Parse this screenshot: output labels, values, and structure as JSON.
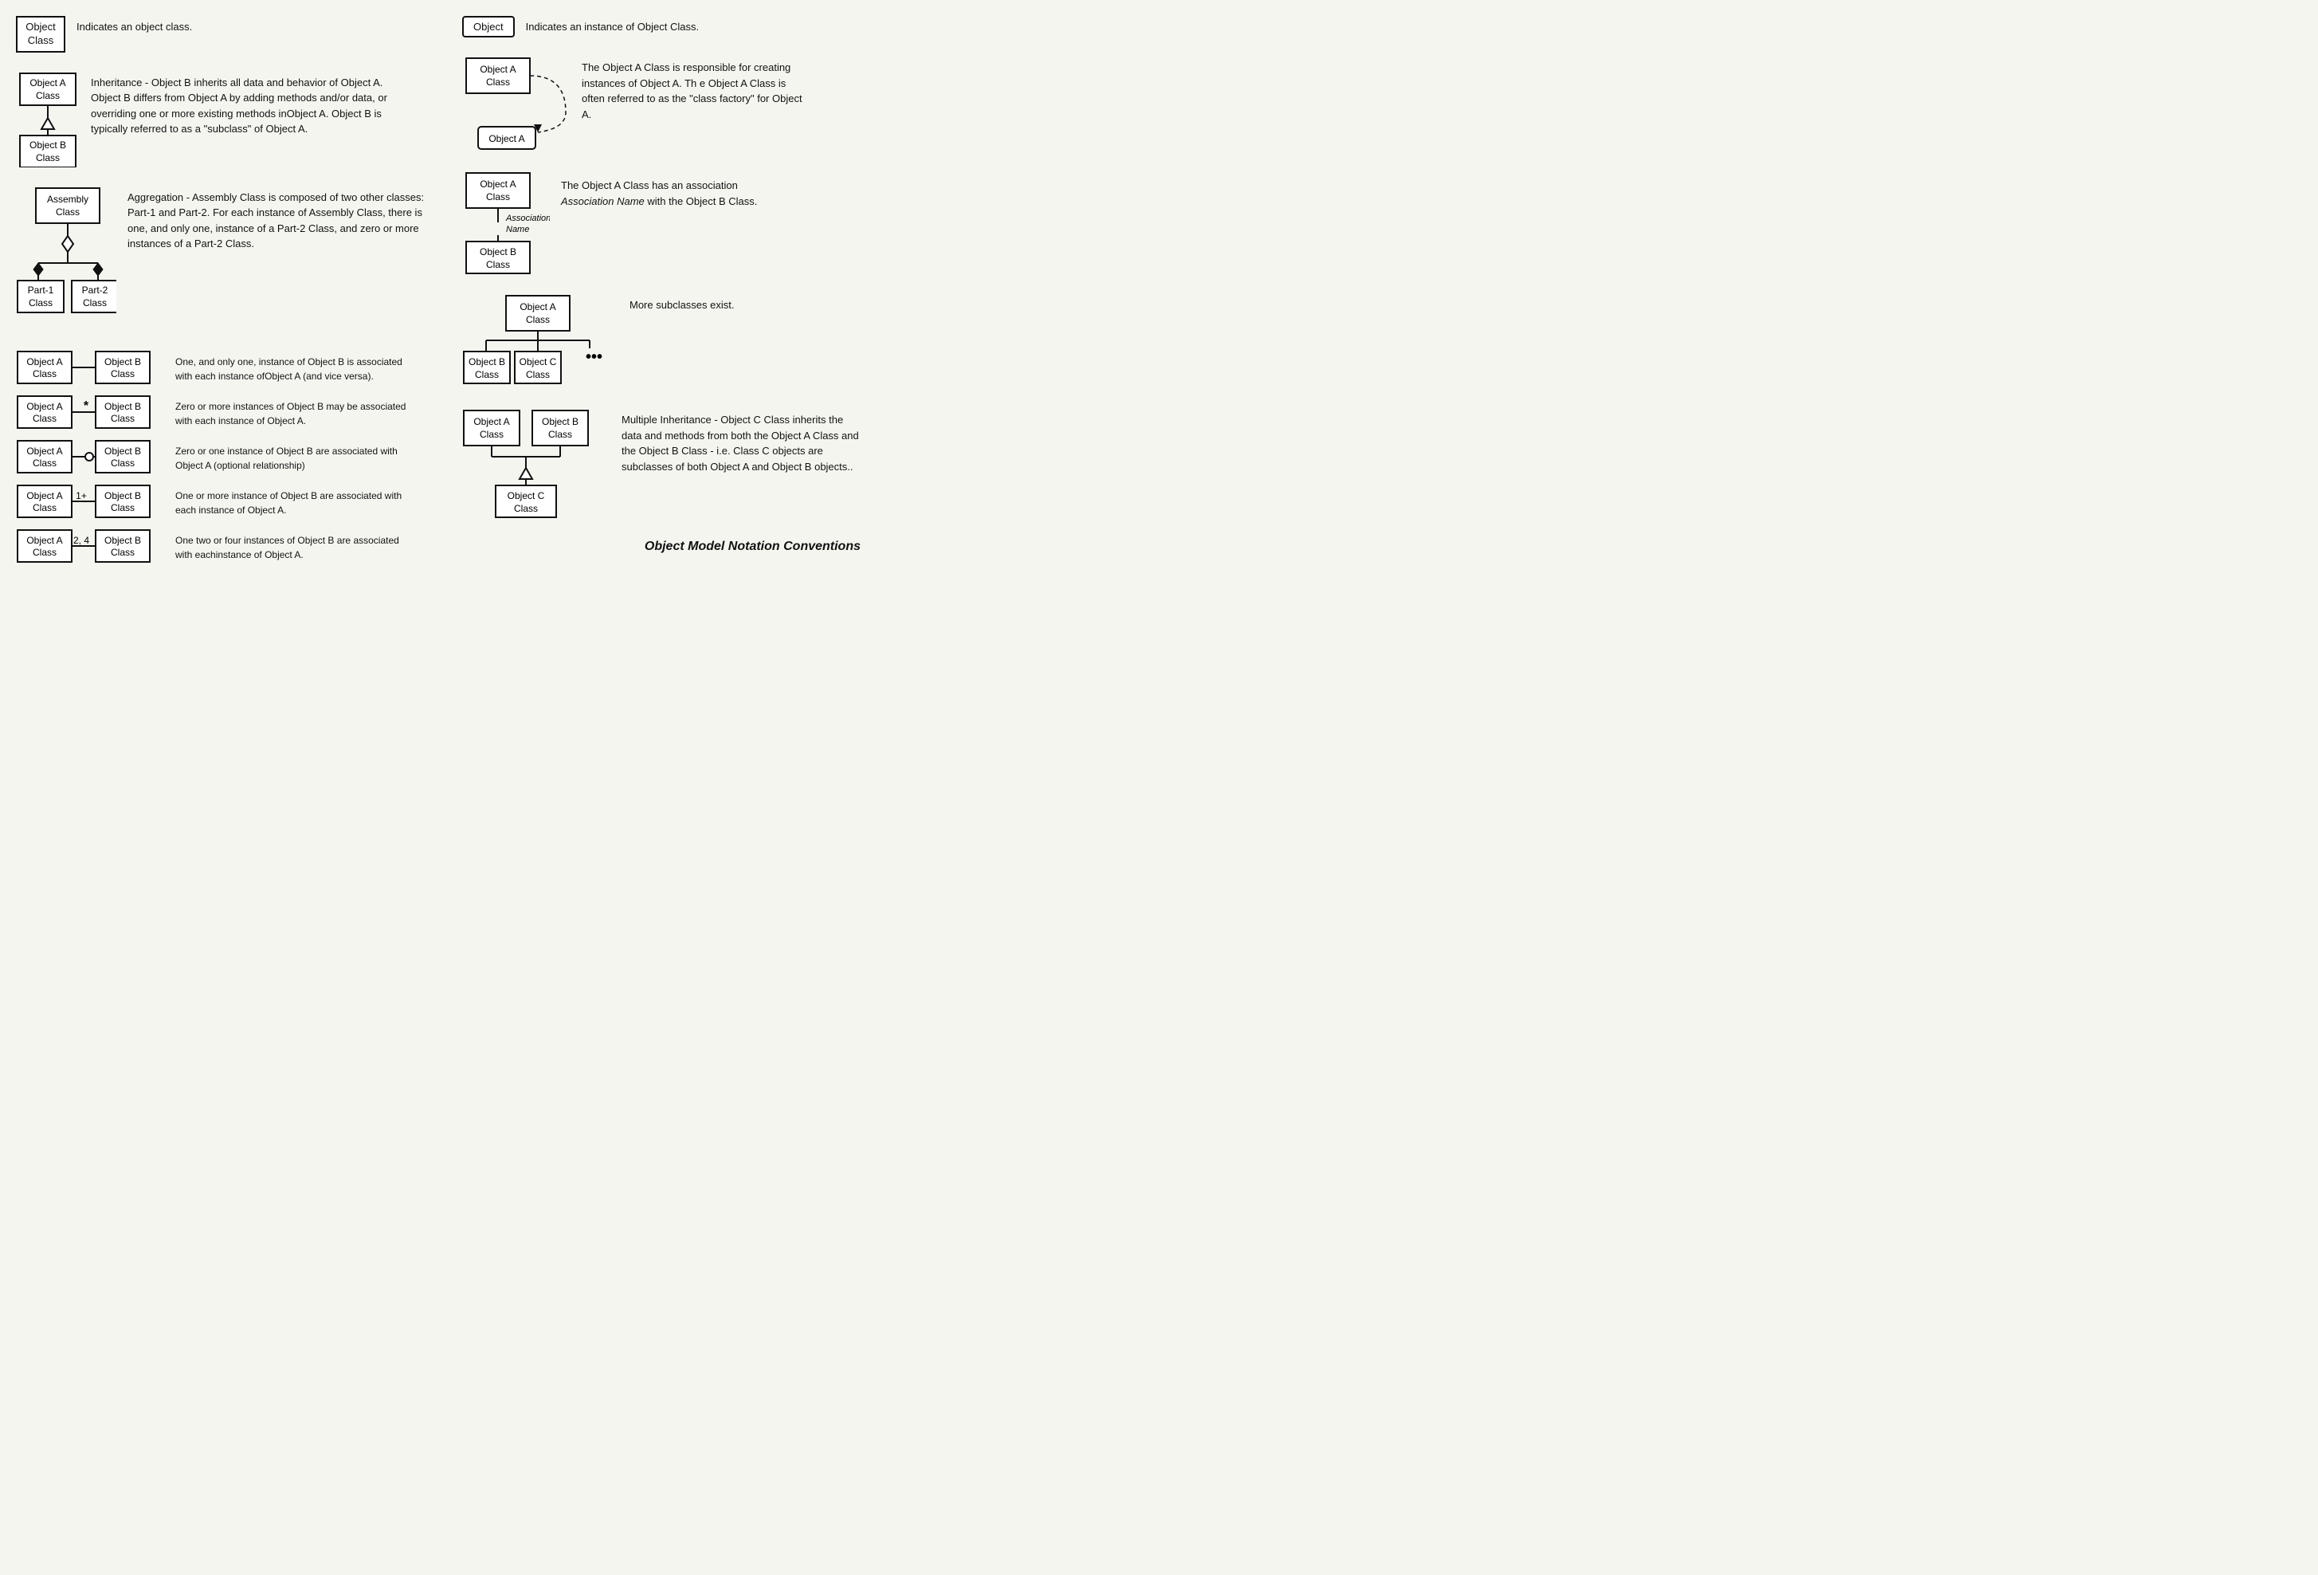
{
  "left": {
    "section1": {
      "box": "Object\nClass",
      "desc": "Indicates an object class."
    },
    "section2": {
      "boxA": "Object A\nClass",
      "boxB": "Object B\nClass",
      "desc": "Inheritance - Object B inherits all data and behavior of Object A. Object B differs from Object A by adding methods and/or data, or overriding one or more existing methods inObject A. Object B is typically referred to as a \"subclass\" of Object A."
    },
    "section3": {
      "boxAssembly": "Assembly\nClass",
      "boxPart1": "Part-1\nClass",
      "boxPart2": "Part-2\nClass",
      "desc": "Aggregation - Assembly Class is composed of two other classes: Part-1 and Part-2.  For each instance of Assembly Class, there is one, and only one, instance of a Part-2 Class, and zero or more instances of a Part-2 Class."
    },
    "assoc_rows": [
      {
        "labelA": "Object A\nClass",
        "connector": "line",
        "labelB": "Object B\nClass",
        "desc": "One, and only one, instance of Object B is associated with each instance ofObject A (and vice versa)."
      },
      {
        "labelA": "Object A\nClass",
        "connector": "star",
        "labelB": "Object B\nClass",
        "desc": "Zero or more instances of Object B may be associated with each instance of Object A."
      },
      {
        "labelA": "Object A\nClass",
        "connector": "circle",
        "labelB": "Object B\nClass",
        "desc": "Zero or one instance of Object B are associated with Object A (optional relationship)"
      },
      {
        "labelA": "Object A\nClass",
        "connector": "1+",
        "labelB": "Object B\nClass",
        "desc": "One or more instance of Object B are associated with each instance of Object A."
      },
      {
        "labelA": "Object A\nClass",
        "connector": "2,4",
        "labelB": "Object B\nClass",
        "desc": "One two or four instances of Object B are associated with eachinstance of Object A."
      }
    ]
  },
  "right": {
    "instance": {
      "box": "Object",
      "desc": "Indicates an instance of Object Class."
    },
    "factory": {
      "boxA": "Object A\nClass",
      "boxInstance": "Object A",
      "desc": "The Object A Class is responsible for creating instances of Object A. Th e Object A Class is often referred to as the \"class factory\" for Object A."
    },
    "association": {
      "boxA": "Object A\nClass",
      "assocName": "Association\nName",
      "boxB": "Object B\nClass",
      "desc": "The Object A Class has an association Association Name with the Object B Class."
    },
    "subclasses": {
      "boxParent": "Object A\nClass",
      "boxB": "Object B\nClass",
      "boxC": "Object C\nClass",
      "dots": "•••",
      "desc": "More subclasses exist."
    },
    "multiInherit": {
      "boxA": "Object A\nClass",
      "boxB": "Object B\nClass",
      "boxC": "Object C\nClass",
      "desc": "Multiple Inheritance - Object C Class inherits the data and methods from both the Object A Class and the Object B Class - i.e. Class C objects are subclasses of both Object A and Object B objects.."
    },
    "footer": "Object Model Notation Conventions"
  }
}
